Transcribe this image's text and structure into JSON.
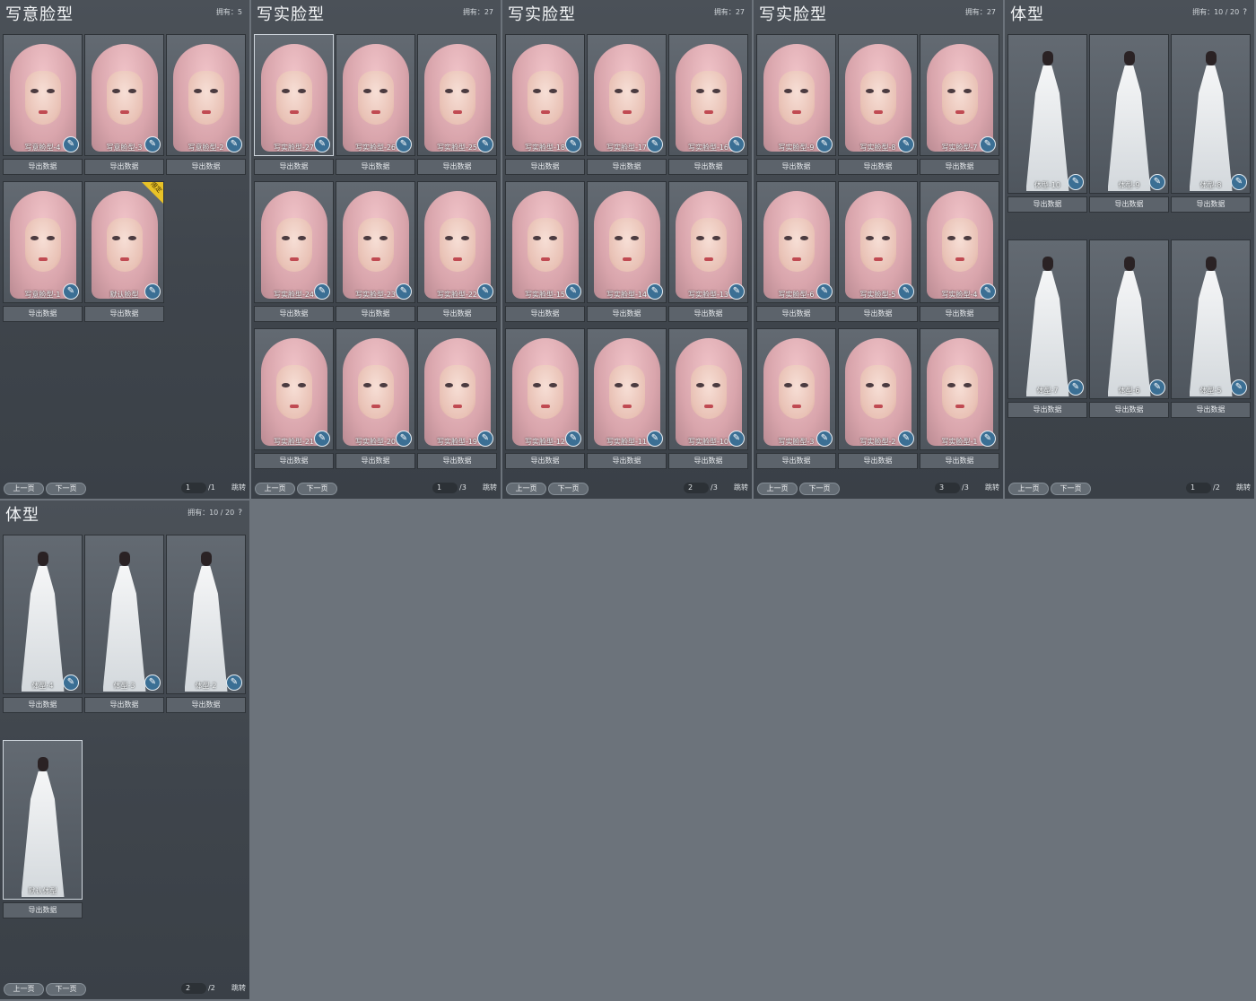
{
  "owned_label": "拥有：",
  "export_label": "导出数据",
  "prev_label": "上一页",
  "next_label": "下一页",
  "jump_label": "跳转",
  "tag_label": "限定",
  "help_label": "?",
  "panels": [
    {
      "title": "写意脸型",
      "count": "5",
      "page": "1",
      "total": "/1",
      "kind": "face",
      "items": [
        {
          "label": "写意脸型-4"
        },
        {
          "label": "写意脸型-3"
        },
        {
          "label": "写意脸型-2"
        },
        {
          "label": "写意脸型-1"
        },
        {
          "label": "默认脸型"
        }
      ]
    },
    {
      "title": "写实脸型",
      "count": "27",
      "page": "1",
      "total": "/3",
      "kind": "face",
      "items": [
        {
          "label": "写实脸型-27"
        },
        {
          "label": "写实脸型-26"
        },
        {
          "label": "写实脸型-25"
        },
        {
          "label": "写实脸型-24"
        },
        {
          "label": "写实脸型-23"
        },
        {
          "label": "写实脸型-22"
        },
        {
          "label": "写实脸型-21"
        },
        {
          "label": "写实脸型-20"
        },
        {
          "label": "写实脸型-19"
        }
      ]
    },
    {
      "title": "写实脸型",
      "count": "27",
      "page": "2",
      "total": "/3",
      "kind": "face",
      "items": [
        {
          "label": "写实脸型-18"
        },
        {
          "label": "写实脸型-17"
        },
        {
          "label": "写实脸型-16"
        },
        {
          "label": "写实脸型-15"
        },
        {
          "label": "写实脸型-14"
        },
        {
          "label": "写实脸型-13"
        },
        {
          "label": "写实脸型-12"
        },
        {
          "label": "写实脸型-11"
        },
        {
          "label": "写实脸型-10"
        }
      ]
    },
    {
      "title": "写实脸型",
      "count": "27",
      "page": "3",
      "total": "/3",
      "kind": "face",
      "items": [
        {
          "label": "写实脸型-9"
        },
        {
          "label": "写实脸型-8"
        },
        {
          "label": "写实脸型-7"
        },
        {
          "label": "写实脸型-6"
        },
        {
          "label": "写实脸型-5"
        },
        {
          "label": "写实脸型-4"
        },
        {
          "label": "写实脸型-3"
        },
        {
          "label": "写实脸型-2"
        },
        {
          "label": "写实脸型-1"
        }
      ]
    },
    {
      "title": "体型",
      "count": "10 / 20",
      "page": "1",
      "total": "/2",
      "kind": "body",
      "items": [
        {
          "label": "体型-10"
        },
        {
          "label": "体型-9"
        },
        {
          "label": "体型-8"
        },
        {
          "label": "体型-7"
        },
        {
          "label": "体型-6"
        },
        {
          "label": "体型-5"
        }
      ]
    },
    {
      "title": "体型",
      "count": "10 / 20",
      "page": "2",
      "total": "/2",
      "kind": "body",
      "items": [
        {
          "label": "体型-4"
        },
        {
          "label": "体型-3"
        },
        {
          "label": "体型-2"
        },
        {
          "label": "默认体型"
        }
      ]
    }
  ]
}
